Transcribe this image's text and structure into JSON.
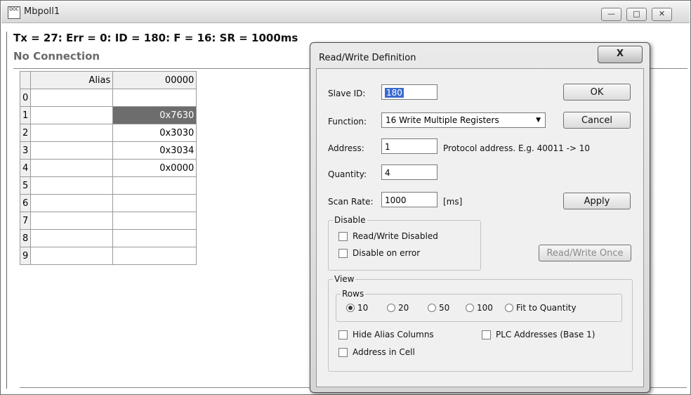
{
  "window": {
    "title": "Mbpoll1",
    "minimize_glyph": "—",
    "maximize_glyph": "□",
    "close_glyph": "✕"
  },
  "status": {
    "line": "Tx = 27: Err = 0: ID = 180: F = 16: SR = 1000ms",
    "connection": "No Connection"
  },
  "grid": {
    "headers": {
      "alias": "Alias",
      "address": "00000"
    },
    "rows": [
      {
        "idx": "0",
        "alias": "",
        "value": ""
      },
      {
        "idx": "1",
        "alias": "",
        "value": "0x7630"
      },
      {
        "idx": "2",
        "alias": "",
        "value": "0x3030"
      },
      {
        "idx": "3",
        "alias": "",
        "value": "0x3034"
      },
      {
        "idx": "4",
        "alias": "",
        "value": "0x0000"
      },
      {
        "idx": "5",
        "alias": "",
        "value": ""
      },
      {
        "idx": "6",
        "alias": "",
        "value": ""
      },
      {
        "idx": "7",
        "alias": "",
        "value": ""
      },
      {
        "idx": "8",
        "alias": "",
        "value": ""
      },
      {
        "idx": "9",
        "alias": "",
        "value": ""
      }
    ]
  },
  "dialog": {
    "title": "Read/Write Definition",
    "close_glyph": "X",
    "slave_id": {
      "label": "Slave ID:",
      "value": "180"
    },
    "function": {
      "label": "Function:",
      "value": "16 Write Multiple Registers",
      "arrow": "▼"
    },
    "address": {
      "label": "Address:",
      "value": "1",
      "hint": "Protocol address. E.g. 40011 -> 10"
    },
    "quantity": {
      "label": "Quantity:",
      "value": "4"
    },
    "scan_rate": {
      "label": "Scan Rate:",
      "value": "1000",
      "unit": "[ms]"
    },
    "buttons": {
      "ok": "OK",
      "cancel": "Cancel",
      "apply": "Apply",
      "read_write_once": "Read/Write Once"
    },
    "disable": {
      "title": "Disable",
      "rw_disabled": "Read/Write Disabled",
      "on_error": "Disable on error"
    },
    "view": {
      "title": "View",
      "rows_title": "Rows",
      "row_options": [
        "10",
        "20",
        "50",
        "100",
        "Fit to Quantity"
      ],
      "selected_rows": "10",
      "hide_alias": "Hide Alias Columns",
      "plc_addresses": "PLC Addresses (Base 1)",
      "address_in_cell": "Address in Cell"
    }
  }
}
